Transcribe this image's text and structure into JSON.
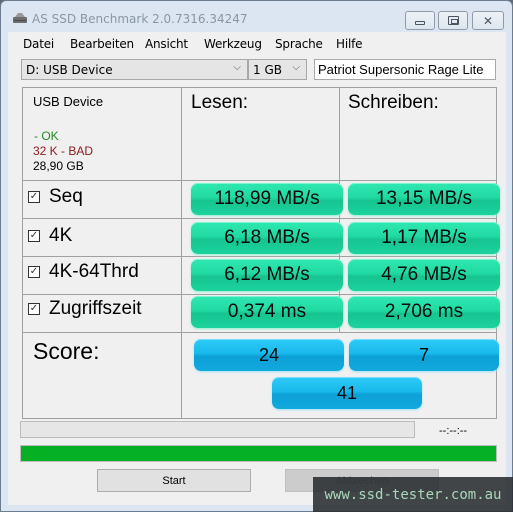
{
  "window": {
    "title": "AS SSD Benchmark 2.0.7316.34247",
    "app_icon": "drive-icon",
    "controls": {
      "minimize": "minimize-icon",
      "maximize": "maximize-icon",
      "close": "✕"
    }
  },
  "menu": {
    "items": [
      "Datei",
      "Bearbeiten",
      "Ansicht",
      "Werkzeug",
      "Sprache",
      "Hilfe"
    ]
  },
  "toolbar": {
    "drive_select": "D: USB Device",
    "size_select": "1 GB",
    "device_name": "Patriot Supersonic Rage Lite",
    "chevron": "⌵"
  },
  "info": {
    "device": "USB Device",
    "status_ok": " - OK",
    "status_bad": "32 K - BAD",
    "capacity": "28,90 GB",
    "colors": {
      "ok": "#228b22",
      "bad": "#8b1a1a"
    }
  },
  "headers": {
    "read": "Lesen:",
    "write": "Schreiben:"
  },
  "tests": [
    {
      "label": "Seq",
      "checked": true,
      "read": "118,99 MB/s",
      "write": "13,15 MB/s"
    },
    {
      "label": "4K",
      "checked": true,
      "read": "6,18 MB/s",
      "write": "1,17 MB/s"
    },
    {
      "label": "4K-64Thrd",
      "checked": true,
      "read": "6,12 MB/s",
      "write": "4,76 MB/s"
    },
    {
      "label": "Zugriffszeit",
      "checked": true,
      "read": "0,374 ms",
      "write": "2,706 ms"
    }
  ],
  "score": {
    "label": "Score:",
    "read": "24",
    "write": "7",
    "total": "41"
  },
  "progress": {
    "current_fraction": 0,
    "time_remaining": "--:--:--",
    "overall_fraction": 1.0,
    "fill_color": "#06b025"
  },
  "buttons": {
    "start": "Start",
    "abort": "Abbrechen"
  },
  "watermark": "www.ssd-tester.com.au",
  "checkmark": "✓",
  "colors": {
    "result_pill": "#20d9a3",
    "score_pill": "#19b9ec"
  }
}
